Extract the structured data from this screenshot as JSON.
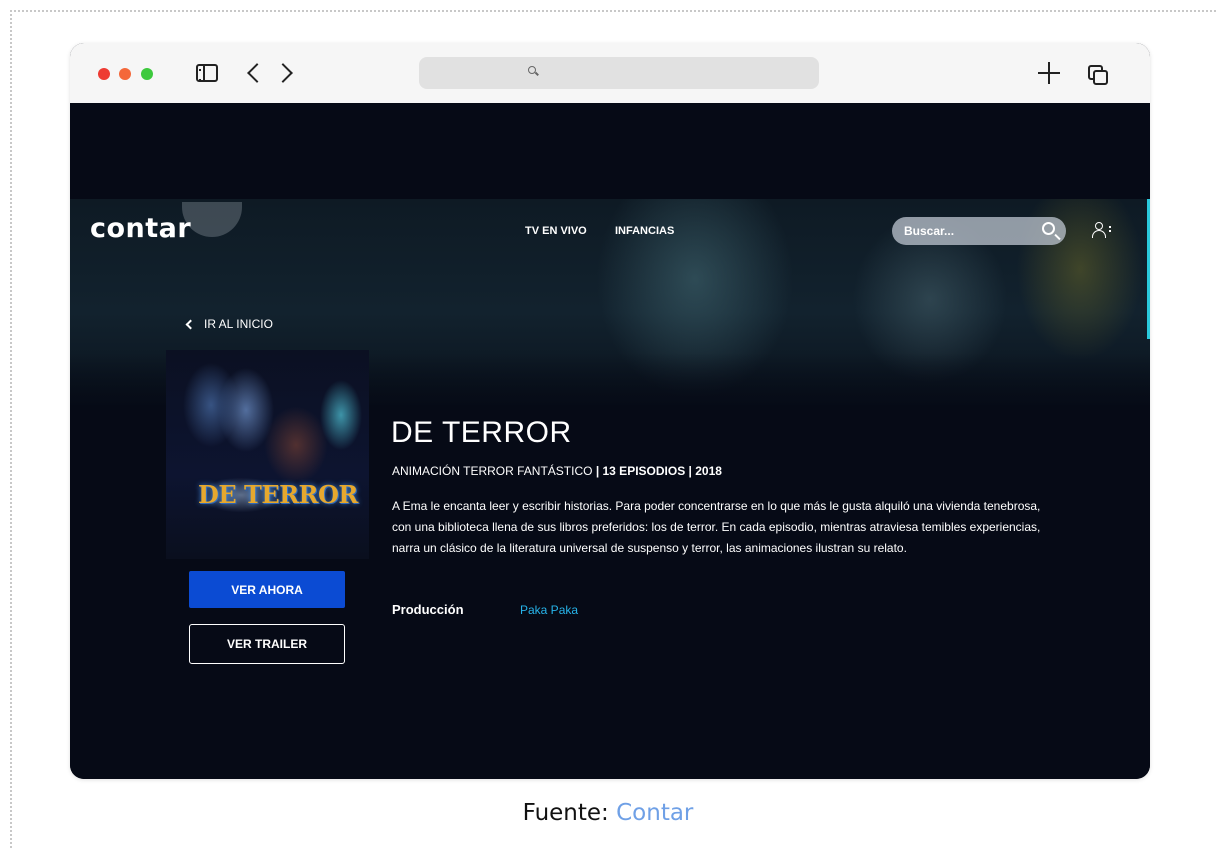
{
  "browser": {
    "address_placeholder": ""
  },
  "site": {
    "logo": "contar",
    "nav": [
      "TV EN VIVO",
      "INFANCIAS"
    ],
    "search_placeholder": "Buscar..."
  },
  "show": {
    "back_label": "IR AL INICIO",
    "poster_title": "DE TERROR",
    "title": "DE TERROR",
    "genre": "ANIMACIÓN TERROR FANTÁSTICO",
    "episodes_year": "| 13 EPISODIOS | 2018",
    "description": "A Ema le encanta leer y escribir historias. Para poder concentrarse en lo que más le gusta alquiló una vivienda tenebrosa, con una biblioteca llena de sus libros preferidos: los de terror. En cada episodio, mientras atraviesa temibles experiencias, narra un clásico de la literatura universal de suspenso y terror, las animaciones ilustran su relato.",
    "production_label": "Producción",
    "production_value": "Paka Paka",
    "watch_label": "VER AHORA",
    "trailer_label": "VER TRAILER"
  },
  "caption": {
    "prefix": "Fuente:",
    "link": "Contar"
  },
  "colors": {
    "accent_blue": "#0b4bd3",
    "link_cyan": "#27b4ea",
    "background": "#060a16"
  }
}
